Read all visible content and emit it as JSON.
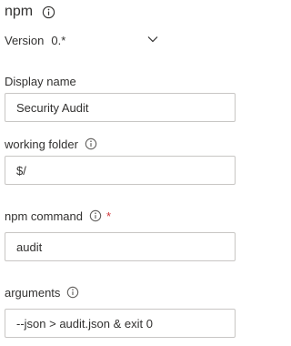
{
  "task": {
    "title": "npm",
    "title_icon": "info-icon"
  },
  "version": {
    "label": "Version",
    "value": "0.*",
    "dropdown_icon": "chevron-down-icon"
  },
  "fields": {
    "display_name": {
      "label": "Display name",
      "value": "Security Audit"
    },
    "working_folder": {
      "label": "working folder",
      "value": "$/",
      "info_icon": "info-icon"
    },
    "npm_command": {
      "label": "npm command",
      "required_mark": "*",
      "value": "audit",
      "info_icon": "info-icon"
    },
    "arguments": {
      "label": "arguments",
      "value": "--json > audit.json & exit 0",
      "info_icon": "info-icon"
    }
  },
  "colors": {
    "text": "#323130",
    "border": "#c8c6c4",
    "required": "#d13438",
    "icon": "#605e5c"
  }
}
